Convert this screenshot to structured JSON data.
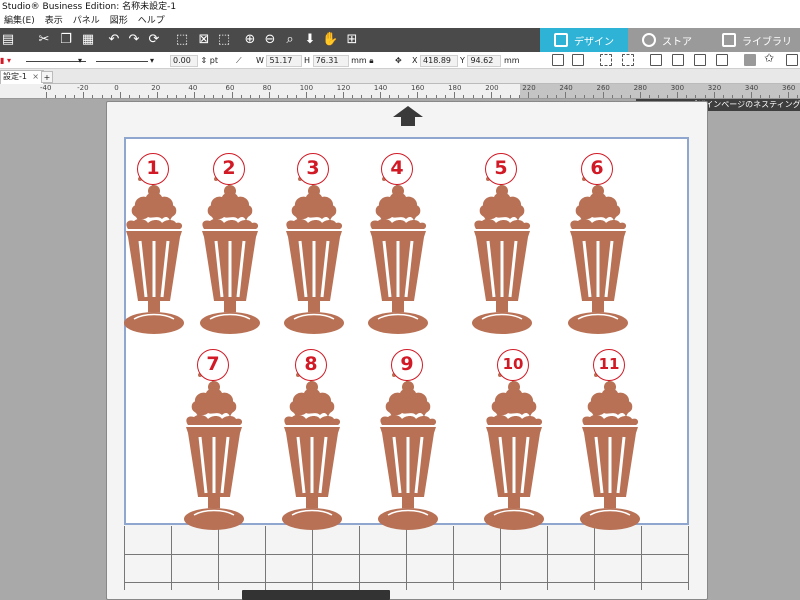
{
  "app": {
    "title": "Studio® Business Edition: 名称未設定-1"
  },
  "menu": [
    "編集(E)",
    "表示",
    "パネル",
    "図形",
    "ヘルプ"
  ],
  "tabs": {
    "design": "デザイン",
    "store": "ストア",
    "library": "ライブラリ"
  },
  "toolbar2": {
    "line_width_value": "0.00",
    "line_width_unit": "pt",
    "w_label": "W",
    "w_value": "51.17",
    "h_label": "H",
    "h_value": "76.31",
    "size_unit": "mm",
    "x_label": "X",
    "x_value": "418.89",
    "y_label": "Y",
    "y_value": "94.62",
    "pos_unit": "mm"
  },
  "doc_tab": {
    "label": "設定-1",
    "close": "×",
    "add": "+"
  },
  "ruler_labels": [
    "-40",
    "-20",
    "0",
    "20",
    "40",
    "60",
    "80",
    "100",
    "120",
    "140",
    "160",
    "180",
    "200",
    "220",
    "240",
    "260",
    "280",
    "300",
    "320",
    "340",
    "360"
  ],
  "nesting_panel": {
    "title": "デザインページのネスティング"
  },
  "colors": {
    "accent": "#2eb3d6",
    "shape_fill": "#b87155",
    "badge_red": "#d11a25",
    "dark_toolbar": "#4a4a4a"
  },
  "parfaits": {
    "row1": [
      "1",
      "2",
      "3",
      "4",
      "5",
      "6"
    ],
    "row2": [
      "7",
      "8",
      "9",
      "10",
      "11"
    ]
  }
}
